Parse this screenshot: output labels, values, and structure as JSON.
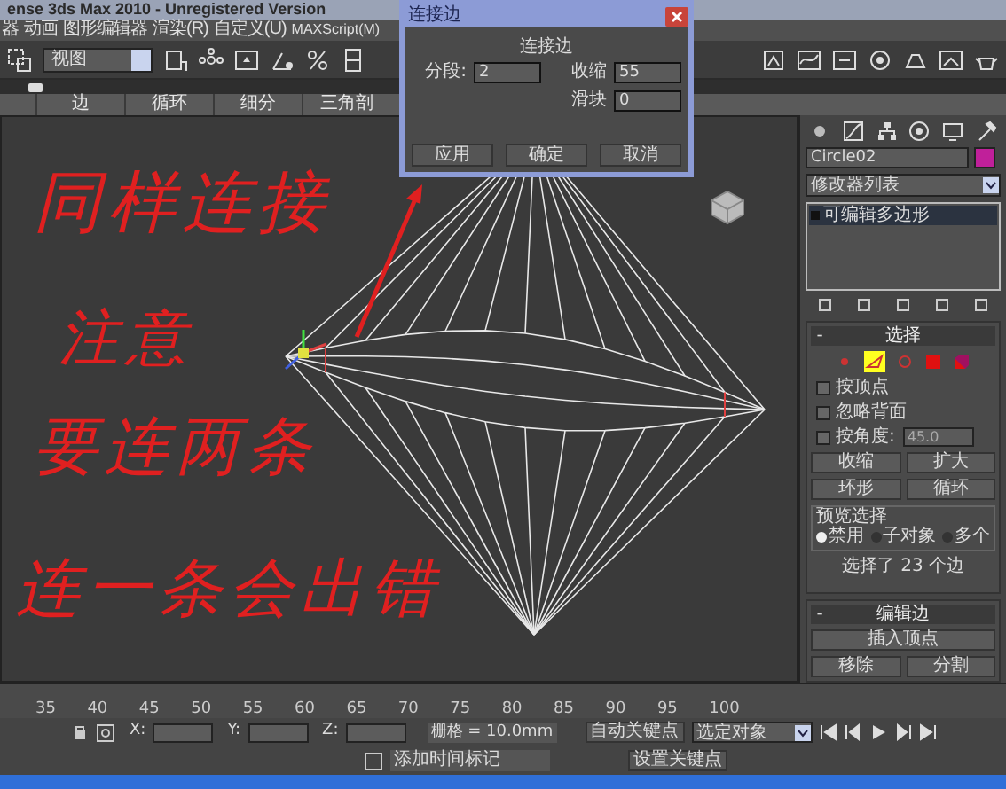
{
  "window": {
    "title": "ense 3ds Max 2010  -  Unregistered Version"
  },
  "menu": [
    "器",
    "动画",
    "图形编辑器",
    "渲染(R)",
    "自定义(U)",
    "MAXScript(M)"
  ],
  "toolbar": {
    "view_dropdown": "视图"
  },
  "ribbon_tabs": [
    "边",
    "循环",
    "细分",
    "三角剖"
  ],
  "dialog": {
    "title": "连接边",
    "heading": "连接边",
    "fields": [
      {
        "label": "分段:",
        "value": "2"
      },
      {
        "label": "收缩",
        "value": "55"
      },
      {
        "label": "滑块",
        "value": "0"
      }
    ],
    "buttons": [
      "应用",
      "确定",
      "取消"
    ]
  },
  "annotations": [
    "同样连接",
    "注意",
    "要连两条",
    "连一条会出错"
  ],
  "command_panel": {
    "object": {
      "name": "Circle02",
      "color": "#c0209a"
    },
    "modifier_list": "修改器列表",
    "stack": [
      {
        "label": "可编辑多边形",
        "selected": true
      }
    ],
    "selection": {
      "toggle": "-",
      "title": "选择",
      "checkboxes": [
        {
          "label": "按顶点",
          "checked": false
        },
        {
          "label": "忽略背面",
          "checked": false
        },
        {
          "label": "按角度:",
          "checked": false
        }
      ],
      "angle_value": "45.0",
      "buttons": [
        "收缩",
        "扩大"
      ],
      "spin_buttons": [
        "环形",
        "循环"
      ],
      "preview": {
        "title": "预览选择",
        "options": [
          {
            "label": "禁用",
            "selected": true
          },
          {
            "label": "子对象",
            "selected": false
          },
          {
            "label": "多个",
            "selected": false
          }
        ]
      },
      "status": "选择了 23 个边"
    },
    "edit_edges": {
      "toggle": "-",
      "title": "编辑边",
      "buttons": [
        "插入顶点",
        "移除",
        "分割"
      ]
    }
  },
  "timeline": {
    "ticks": [
      "35",
      "40",
      "45",
      "50",
      "55",
      "60",
      "65",
      "70",
      "75",
      "80",
      "85",
      "90",
      "95",
      "100"
    ]
  },
  "status_bar": {
    "x_label": "X:",
    "y_label": "Y:",
    "z_label": "Z:",
    "grid": "栅格 = 10.0mm",
    "auto_key": "自动关键点",
    "key_filter": "选定对象",
    "add_tag": "添加时间标记",
    "set_key": "设置关键点"
  }
}
